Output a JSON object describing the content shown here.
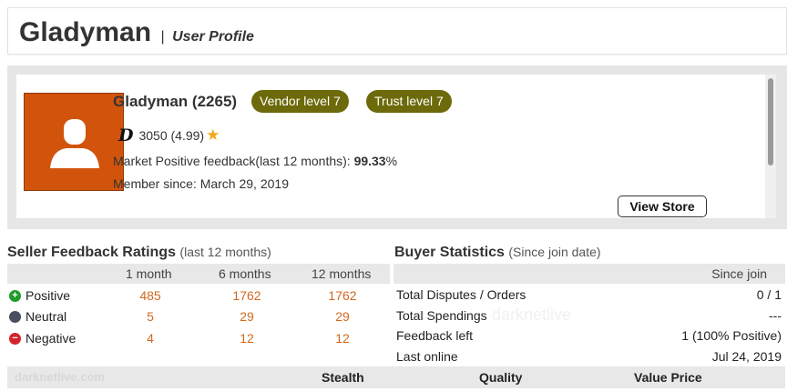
{
  "header": {
    "name": "Gladyman",
    "separator": "|",
    "subtitle": "User Profile"
  },
  "profile": {
    "username": "Gladyman (2265)",
    "badges": {
      "vendor": "Vendor level 7",
      "trust": "Trust level 7"
    },
    "rating": {
      "icon_glyph": "D",
      "text": "3050 (4.99)",
      "star": "★"
    },
    "feedback_label": "Market Positive feedback(last 12 months):",
    "feedback_value": "99.33",
    "feedback_pct": "%",
    "member_since": "Member since: March 29, 2019",
    "view_store_label": "View Store"
  },
  "seller": {
    "title": "Seller Feedback Ratings",
    "subtitle": "(last 12 months)",
    "columns": [
      "1 month",
      "6 months",
      "12 months"
    ],
    "rows": [
      {
        "label": "Positive",
        "symbol": "+",
        "values": [
          "485",
          "1762",
          "1762"
        ]
      },
      {
        "label": "Neutral",
        "symbol": "",
        "values": [
          "5",
          "29",
          "29"
        ]
      },
      {
        "label": "Negative",
        "symbol": "−",
        "values": [
          "4",
          "12",
          "12"
        ]
      }
    ]
  },
  "buyer": {
    "title": "Buyer Statistics",
    "subtitle": "(Since join date)",
    "column": "Since join",
    "rows": [
      {
        "label": "Total Disputes / Orders",
        "value": "0 / 1"
      },
      {
        "label": "Total Spendings",
        "value": "---"
      },
      {
        "label": "Feedback left",
        "value": "1 (100% Positive)"
      },
      {
        "label": "Last online",
        "value": "Jul 24, 2019"
      }
    ]
  },
  "watermark": "darknetlive",
  "footer": {
    "watermark": "darknetlive.com",
    "columns": [
      "Stealth",
      "Quality",
      "Value Price"
    ]
  },
  "colors": {
    "accent": "#d2691e",
    "badge": "#6c6a0a",
    "avatar_bg": "#d2540c"
  },
  "icons": {
    "avatar": "user-silhouette-icon",
    "rating": "d-logo-icon",
    "star": "star-icon"
  }
}
